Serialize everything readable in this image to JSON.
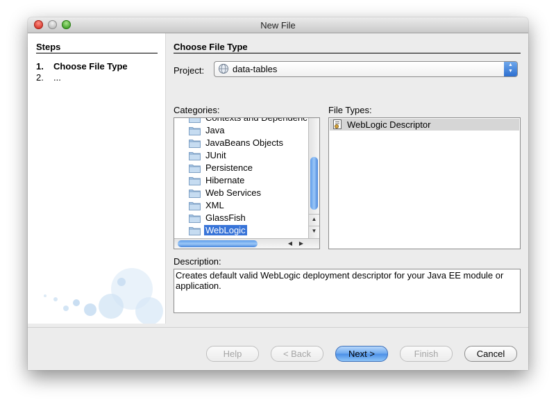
{
  "window": {
    "title": "New File"
  },
  "steps": {
    "header": "Steps",
    "items": [
      {
        "num": "1.",
        "label": "Choose File Type"
      },
      {
        "num": "2.",
        "label": "..."
      }
    ]
  },
  "main": {
    "section_title": "Choose File Type",
    "project_label": "Project:",
    "project_value": "data-tables",
    "categories_label": "Categories:",
    "categories": [
      "Contexts and Dependenc",
      "Java",
      "JavaBeans Objects",
      "JUnit",
      "Persistence",
      "Hibernate",
      "Web Services",
      "XML",
      "GlassFish",
      "WebLogic"
    ],
    "selected_category": "WebLogic",
    "file_types_label": "File Types:",
    "file_types": [
      "WebLogic Descriptor"
    ],
    "description_label": "Description:",
    "description": "Creates default valid WebLogic deployment descriptor for your Java EE module or application."
  },
  "buttons": {
    "help": "Help",
    "back": "< Back",
    "next": "Next >",
    "finish": "Finish",
    "cancel": "Cancel"
  },
  "colors": {
    "selection": "#3874d8",
    "default_button": "#4a8ee6",
    "file_type_highlight": "#d6d6d6"
  },
  "icons": {
    "category": "folder-icon",
    "file_type": "descriptor-file-icon",
    "project": "globe-icon"
  }
}
